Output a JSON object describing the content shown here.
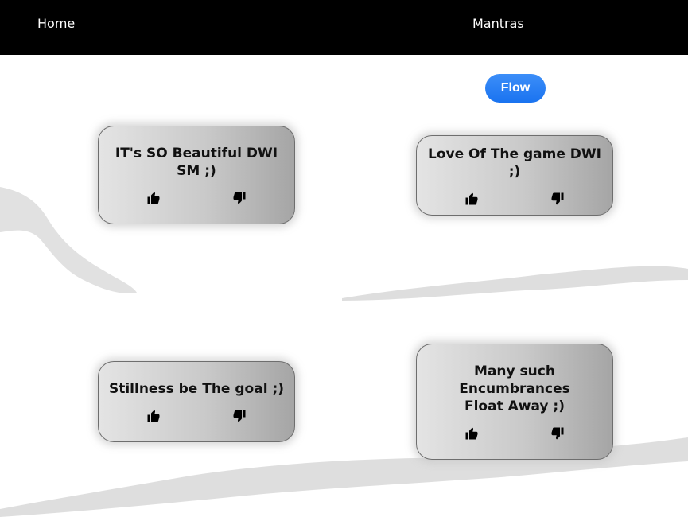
{
  "nav": {
    "home": "Home",
    "mantras": "Mantras"
  },
  "flow_button": "Flow",
  "cards": [
    {
      "text": "IT's SO Beautiful DWI SM ;)"
    },
    {
      "text": "Love Of The game DWI ;)"
    },
    {
      "text": "Stillness be The goal ;)"
    },
    {
      "text": "Many such Encumbrances Float Away ;)"
    }
  ],
  "icons": {
    "like": "thumbs-up-icon",
    "dislike": "thumbs-down-icon"
  },
  "colors": {
    "nav_bg": "#000000",
    "flow_button": "#1a73f0"
  }
}
